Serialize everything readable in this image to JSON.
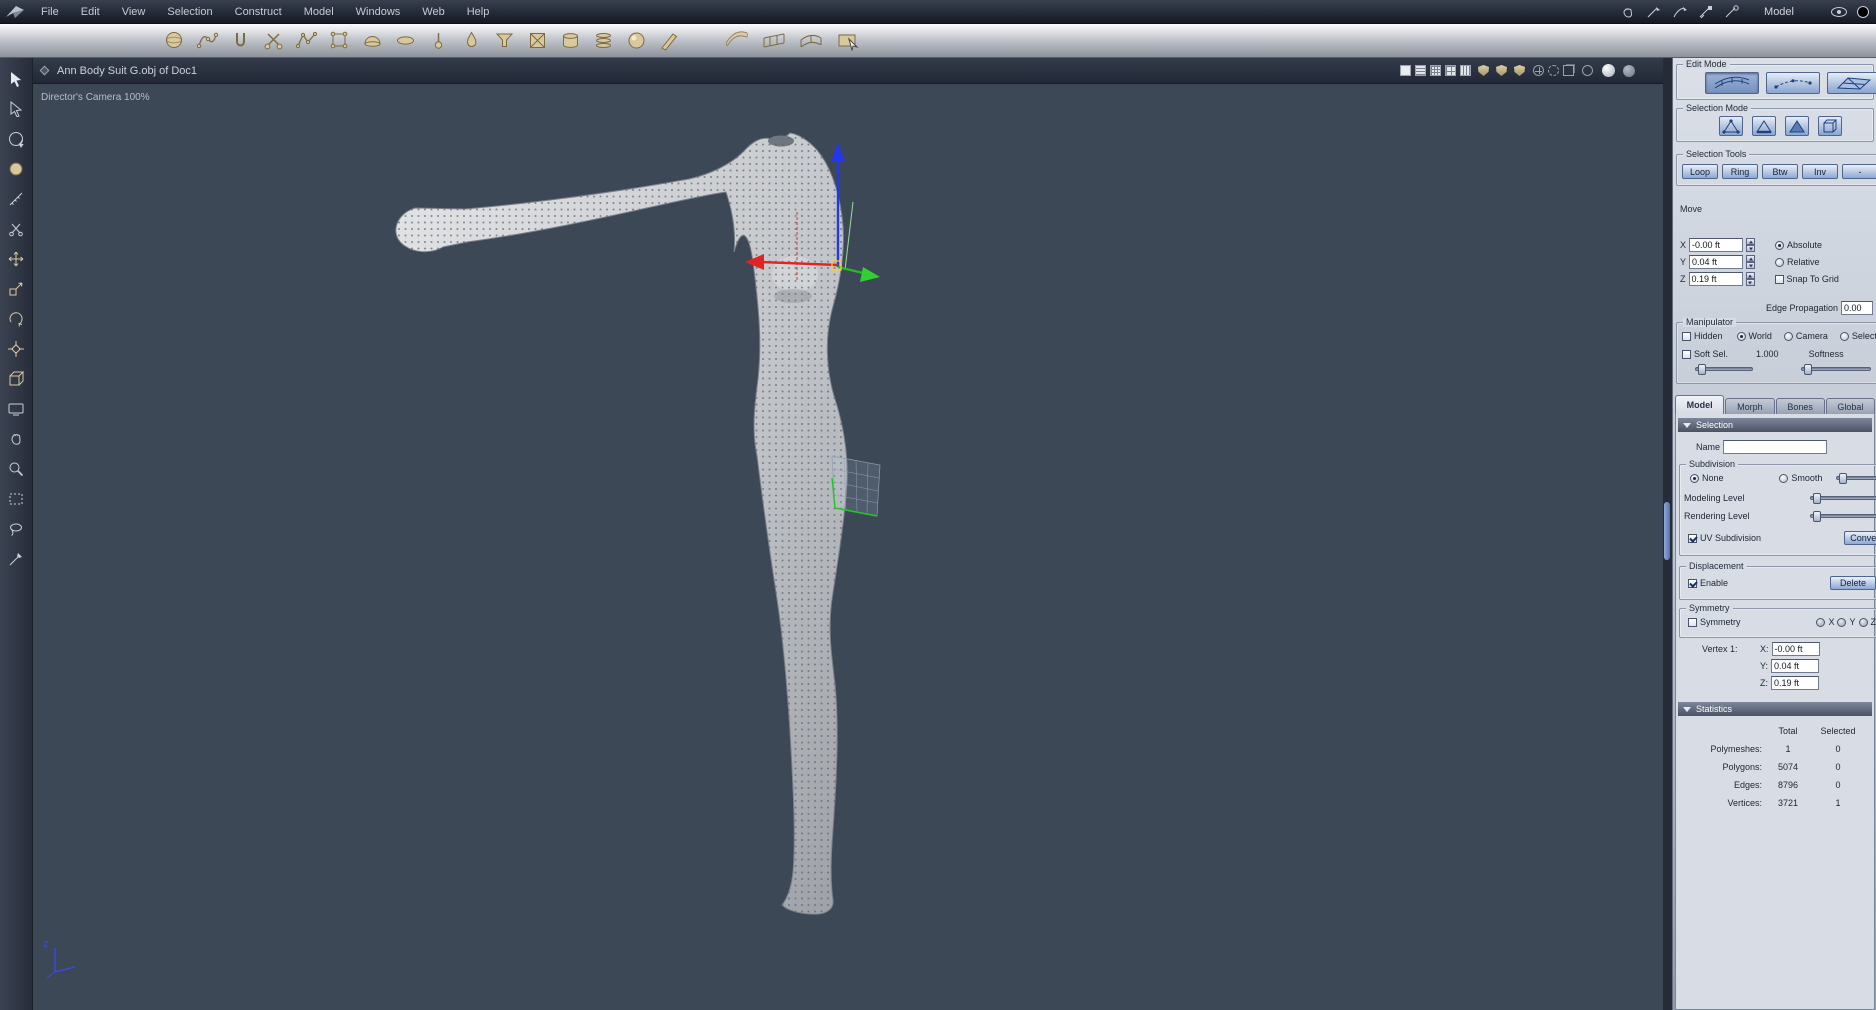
{
  "menubar": {
    "logo_icon": "app-logo-icon",
    "items": [
      "File",
      "Edit",
      "View",
      "Selection",
      "Construct",
      "Model",
      "Windows",
      "Web",
      "Help"
    ],
    "right_icons": [
      "grab-hand-icon",
      "pen-tool-1-icon",
      "pen-tool-2-icon",
      "pen-tool-3-icon",
      "pen-tool-4-icon"
    ],
    "mode_label": "Model",
    "far_right_icons": [
      "eye-icon",
      "render-sphere-icon"
    ]
  },
  "toolbar": {
    "icons": [
      "sphere-primitive-icon",
      "curve-edit-icon",
      "clip-tool-icon",
      "scissors-icon",
      "polyline-icon",
      "vertex-box-icon",
      "dome-icon",
      "disc-icon",
      "pin-icon",
      "droplet-icon",
      "funnel-icon",
      "boxed-x-icon",
      "cylinder-icon",
      "stack-icon",
      "shaded-ball-icon",
      "pencil-icon"
    ],
    "surface_icons": [
      "sweep-surface-icon",
      "ruled-surface-icon",
      "loft-surface-icon",
      "pick-surface-icon"
    ]
  },
  "left_toolbar": {
    "tools": [
      "select-arrow-icon",
      "direct-select-icon",
      "orbit-rotate-icon",
      "paint-sphere-icon",
      "measure-line-icon",
      "cut-scissors-icon",
      "move-tool-icon",
      "scale-tool-icon",
      "rotate-tool-icon",
      "manipulator-tool-icon",
      "box-tool-icon",
      "camera-view-icon",
      "pan-hand-icon",
      "zoom-icon",
      "marquee-select-icon",
      "lasso-select-icon",
      "knife-tool-icon"
    ]
  },
  "viewport": {
    "title": "Ann Body Suit G.obj of Doc1",
    "camera_label": "Director's Camera 100%",
    "axis_label": "z",
    "titlebar_icons": [
      {
        "name": "display-solid-icon",
        "kind": "square-solid"
      },
      {
        "name": "display-lines-icon",
        "kind": "square-lines"
      },
      {
        "name": "display-grid-icon",
        "kind": "square-grid2"
      },
      {
        "name": "display-dense-grid-icon",
        "kind": "square-grid"
      },
      {
        "name": "display-mixed-icon",
        "kind": "square-lines2"
      },
      {
        "name": "shield-full-icon",
        "kind": "shield"
      },
      {
        "name": "shield-half-icon",
        "kind": "shield"
      },
      {
        "name": "shield-wire-icon",
        "kind": "shield"
      },
      {
        "name": "axis-circle-icon",
        "kind": "circle-cross"
      },
      {
        "name": "dashed-circle-icon",
        "kind": "circle-dashed"
      },
      {
        "name": "bounding-box-icon",
        "kind": "cube"
      },
      {
        "name": "circle-outline-icon",
        "kind": "circle"
      },
      {
        "name": "shaded-sphere-icon",
        "kind": "sphere-light"
      },
      {
        "name": "gray-sphere-icon",
        "kind": "sphere-dark"
      }
    ]
  },
  "right_panel": {
    "edit_mode": {
      "label": "Edit Mode",
      "buttons": [
        {
          "name": "edit-mode-surface-button",
          "selected": true
        },
        {
          "name": "edit-mode-wire-button",
          "selected": false
        },
        {
          "name": "edit-mode-uv-button",
          "selected": false
        }
      ]
    },
    "selection_mode": {
      "label": "Selection Mode",
      "buttons": [
        {
          "name": "select-points-button"
        },
        {
          "name": "select-edges-button"
        },
        {
          "name": "select-faces-button"
        },
        {
          "name": "select-object-button"
        }
      ]
    },
    "selection_tools": {
      "label": "Selection Tools",
      "buttons": [
        "Loop",
        "Ring",
        "Btw",
        "Inv",
        "-",
        ""
      ]
    },
    "move": {
      "label": "Move",
      "x_label": "X",
      "x_value": "-0.00 ft",
      "y_label": "Y",
      "y_value": "0.04 ft",
      "z_label": "Z",
      "z_value": "0.19 ft",
      "absolute_label": "Absolute",
      "relative_label": "Relative",
      "snap_label": "Snap To Grid",
      "edge_propagation_label": "Edge Propagation",
      "edge_propagation_value": "0.00"
    },
    "manipulator": {
      "label": "Manipulator",
      "hidden_label": "Hidden",
      "world_label": "World",
      "camera_label": "Camera",
      "selection_label": "Selection",
      "soft_sel_label": "Soft Sel.",
      "soft_sel_value": "1.000",
      "softness_label": "Softness"
    },
    "tabs": [
      {
        "label": "Model",
        "active": true
      },
      {
        "label": "Morph",
        "active": false
      },
      {
        "label": "Bones",
        "active": false
      },
      {
        "label": "Global",
        "active": false
      }
    ],
    "selection_section": {
      "header": "Selection",
      "name_label": "Name",
      "name_value": ""
    },
    "subdivision": {
      "label": "Subdivision",
      "none_label": "None",
      "smooth_label": "Smooth",
      "modeling_label": "Modeling Level",
      "rendering_label": "Rendering Level",
      "uv_label": "UV Subdivision",
      "convert_label": "Convert"
    },
    "displacement": {
      "label": "Displacement",
      "enable_label": "Enable",
      "delete_label": "Delete"
    },
    "symmetry": {
      "label": "Symmetry",
      "checkbox_label": "Symmetry",
      "x_label": "X",
      "y_label": "Y",
      "z_label": "Z"
    },
    "vertex": {
      "label": "Vertex 1:",
      "x_label": "X:",
      "x_value": "-0.00 ft",
      "y_label": "Y:",
      "y_value": "0.04 ft",
      "z_label": "Z:",
      "z_value": "0.19 ft"
    },
    "statistics": {
      "header": "Statistics",
      "total_label": "Total",
      "selected_label": "Selected",
      "rows": [
        {
          "label": "Polymeshes:",
          "total": "1",
          "selected": "0"
        },
        {
          "label": "Polygons:",
          "total": "5074",
          "selected": "0"
        },
        {
          "label": "Edges:",
          "total": "8796",
          "selected": "0"
        },
        {
          "label": "Vertices:",
          "total": "3721",
          "selected": "1"
        }
      ]
    }
  }
}
